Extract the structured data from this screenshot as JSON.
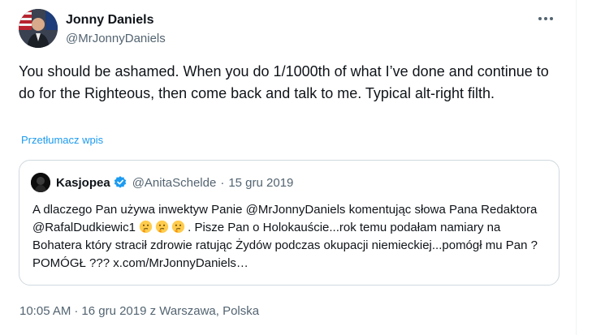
{
  "author": {
    "display_name": "Jonny Daniels",
    "handle": "@MrJonnyDaniels"
  },
  "tweet": {
    "text": "You should be ashamed. When you do 1/1000th of what I’ve done and continue to do for the Righteous, then come back and talk to me. Typical alt-right filth.",
    "translate_label": "Przetłumacz wpis"
  },
  "quote": {
    "display_name": "Kasjopea",
    "handle": "@AnitaSchelde",
    "separator": "·",
    "date": "15 gru 2019",
    "text_part1": "A dlaczego Pan używa inwektyw Panie @MrJonnyDaniels komentując słowa Pana Redaktora @RafalDudkiewic1",
    "text_part2": ". Pisze Pan o Holokauście...rok temu podałam namiary na Bohatera który stracił zdrowie ratując Żydów podczas okupacji niemieckiej...pomógł mu Pan ? POMÓGŁ ??? x.com/MrJonnyDaniels…",
    "emoji_count": 3
  },
  "meta": {
    "time": "10:05 AM",
    "separator": "·",
    "date_location": "16 gru 2019 z Warszawa, Polska"
  },
  "colors": {
    "link": "#1d9bf0",
    "secondary_text": "#536471",
    "border": "#cfd9de",
    "verified": "#1d9bf0"
  },
  "icons": {
    "more": "more-horizontal-icon",
    "verified": "verified-badge-icon",
    "emoji": "thinking-face-emoji"
  }
}
